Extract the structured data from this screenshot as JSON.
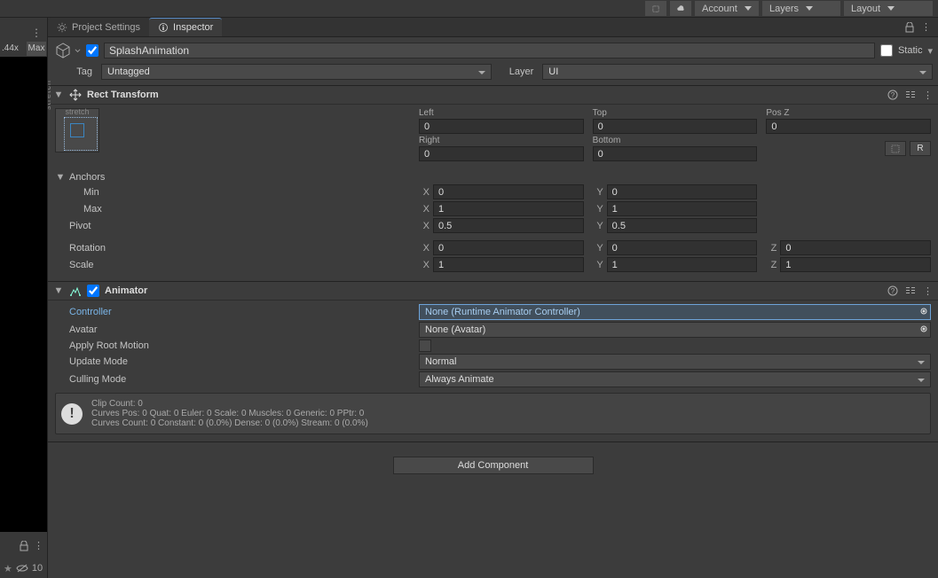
{
  "toolbar": {
    "account": "Account",
    "layers": "Layers",
    "layout": "Layout"
  },
  "tabs": {
    "settings": "Project Settings",
    "inspector": "Inspector"
  },
  "scale_label": ".44x",
  "max_label": "Max",
  "hidden_count": "10",
  "object": {
    "name": "SplashAnimation",
    "static": "Static",
    "tag_label": "Tag",
    "tag_value": "Untagged",
    "layer_label": "Layer",
    "layer_value": "UI"
  },
  "rect_transform": {
    "title": "Rect Transform",
    "stretch": "stretch",
    "left_label": "Left",
    "left": "0",
    "top_label": "Top",
    "top": "0",
    "posz_label": "Pos Z",
    "posz": "0",
    "right_label": "Right",
    "right": "0",
    "bottom_label": "Bottom",
    "bottom": "0",
    "r_button": "R",
    "anchors_label": "Anchors",
    "min_label": "Min",
    "min_x": "0",
    "min_y": "0",
    "max_label": "Max",
    "max_x": "1",
    "max_y": "1",
    "pivot_label": "Pivot",
    "pivot_x": "0.5",
    "pivot_y": "0.5",
    "rotation_label": "Rotation",
    "rot_x": "0",
    "rot_y": "0",
    "rot_z": "0",
    "scale_label": "Scale",
    "scale_x": "1",
    "scale_y": "1",
    "scale_z": "1",
    "x": "X",
    "y": "Y",
    "z": "Z"
  },
  "animator": {
    "title": "Animator",
    "controller_label": "Controller",
    "controller_value": "None (Runtime Animator Controller)",
    "avatar_label": "Avatar",
    "avatar_value": "None (Avatar)",
    "apply_root_label": "Apply Root Motion",
    "update_mode_label": "Update Mode",
    "update_mode_value": "Normal",
    "culling_mode_label": "Culling Mode",
    "culling_mode_value": "Always Animate",
    "info_line1": "Clip Count: 0",
    "info_line2": "Curves Pos: 0 Quat: 0 Euler: 0 Scale: 0 Muscles: 0 Generic: 0 PPtr: 0",
    "info_line3": "Curves Count: 0 Constant: 0 (0.0%) Dense: 0 (0.0%) Stream: 0 (0.0%)"
  },
  "add_component": "Add Component"
}
